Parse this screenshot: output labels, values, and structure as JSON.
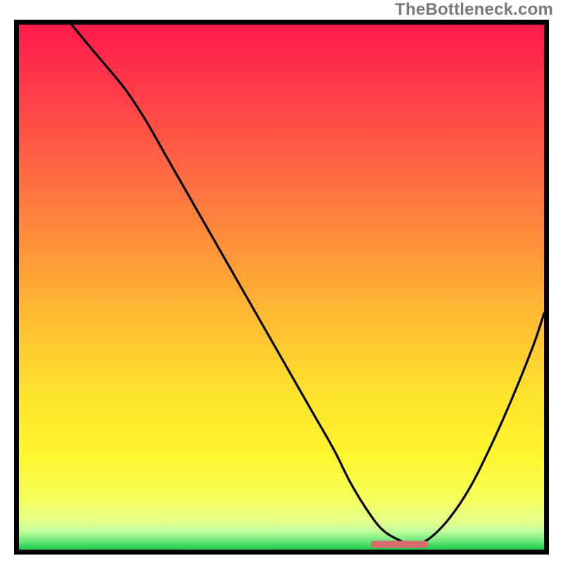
{
  "watermark": "TheBottleneck.com",
  "colors": {
    "frame": "#000000",
    "curve": "#000000",
    "marker": "#d86c6c",
    "gradient_stops": [
      {
        "offset": 0.0,
        "color": "#ff1a4b"
      },
      {
        "offset": 0.12,
        "color": "#ff3a4a"
      },
      {
        "offset": 0.25,
        "color": "#ff6044"
      },
      {
        "offset": 0.4,
        "color": "#ff8c3c"
      },
      {
        "offset": 0.55,
        "color": "#ffb933"
      },
      {
        "offset": 0.7,
        "color": "#ffe22e"
      },
      {
        "offset": 0.82,
        "color": "#fff62e"
      },
      {
        "offset": 0.9,
        "color": "#f7ff58"
      },
      {
        "offset": 0.945,
        "color": "#e6ff8a"
      },
      {
        "offset": 0.965,
        "color": "#c0ff9a"
      },
      {
        "offset": 0.985,
        "color": "#66e57a"
      },
      {
        "offset": 1.0,
        "color": "#18c848"
      }
    ]
  },
  "chart_data": {
    "type": "line",
    "title": "",
    "xlabel": "",
    "ylabel": "",
    "xlim": [
      0,
      100
    ],
    "ylim": [
      0,
      100
    ],
    "series": [
      {
        "name": "bottleneck-curve",
        "x": [
          10,
          15,
          20,
          24,
          28,
          32,
          36,
          40,
          44,
          48,
          52,
          56,
          60,
          63,
          66,
          69,
          72,
          75,
          78,
          82,
          86,
          90,
          94,
          98,
          100
        ],
        "y": [
          100,
          94,
          88,
          82,
          75,
          68,
          61,
          54,
          47,
          40,
          33,
          26,
          19,
          13,
          8,
          4,
          2,
          1,
          2,
          6,
          12,
          20,
          29,
          39,
          45
        ]
      }
    ],
    "annotations": [
      {
        "name": "optimum-marker",
        "shape": "rounded-bar",
        "x_start": 67,
        "x_end": 78,
        "y": 1.0
      }
    ]
  }
}
